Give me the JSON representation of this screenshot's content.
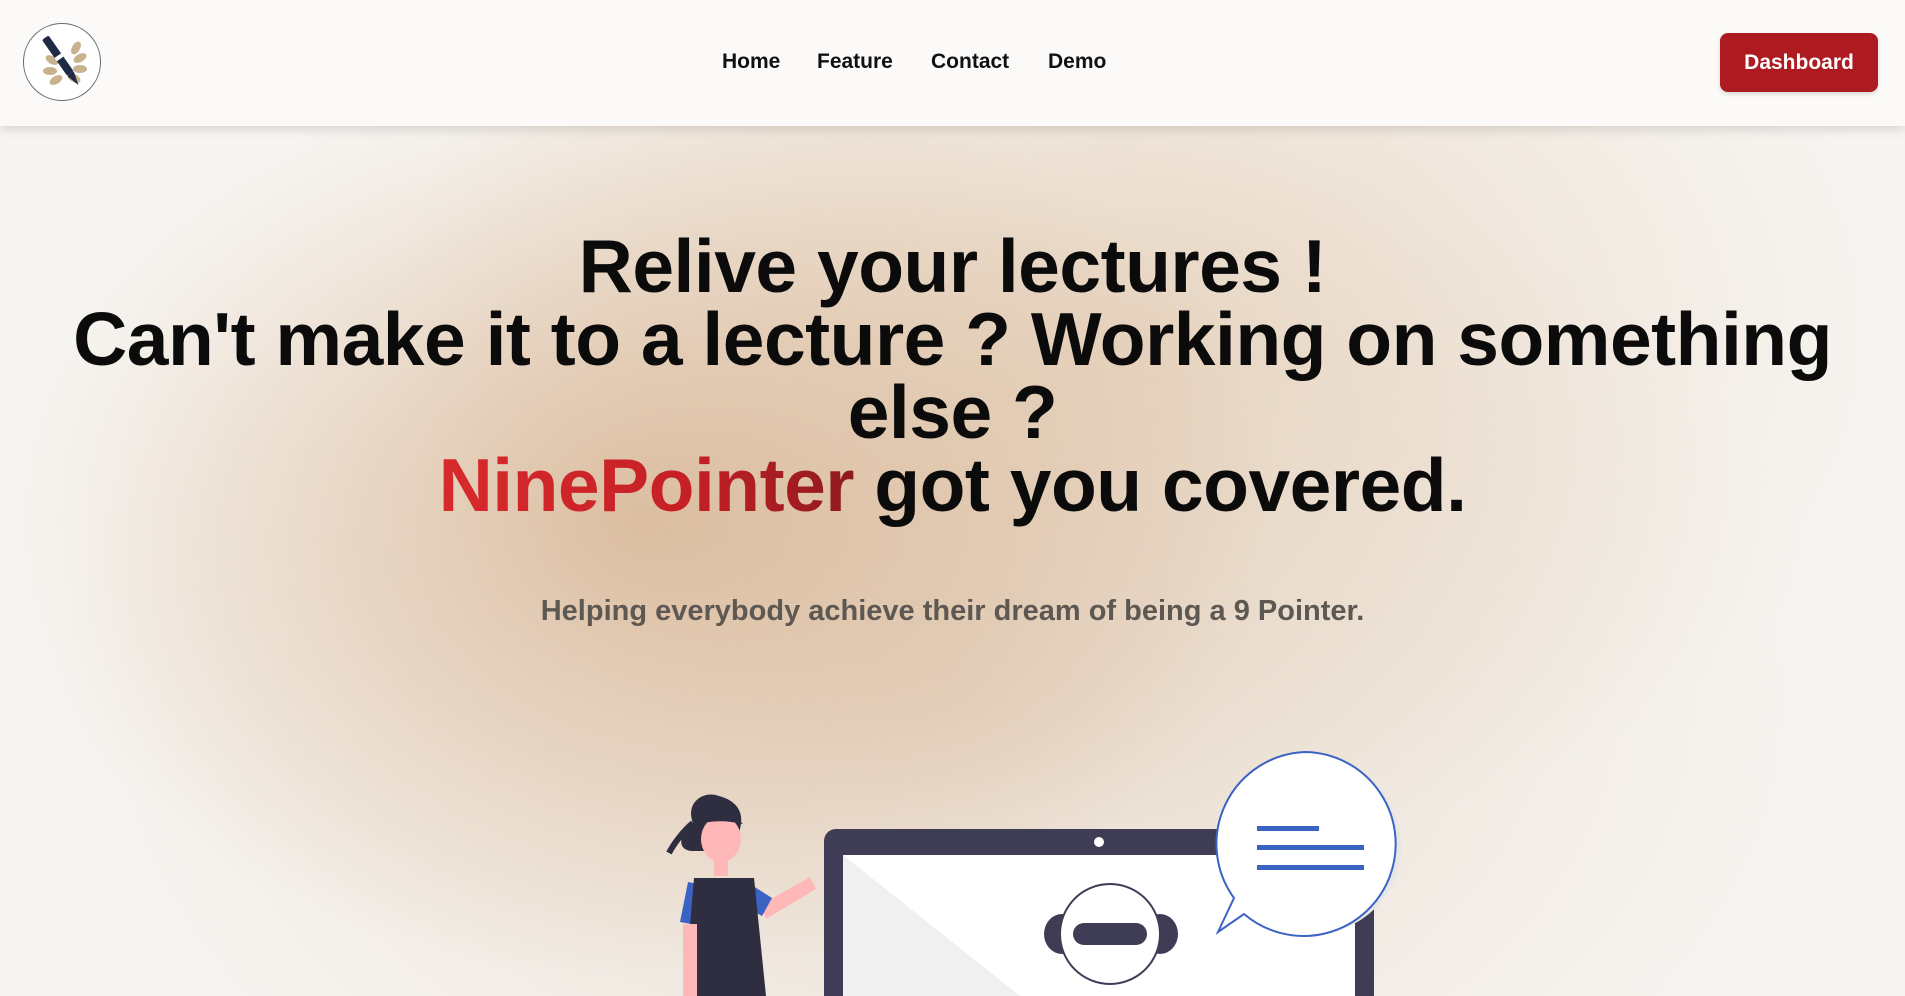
{
  "header": {
    "logo_icon": "pen-feather-logo-icon",
    "nav": [
      {
        "label": "Home"
      },
      {
        "label": "Feature"
      },
      {
        "label": "Contact"
      },
      {
        "label": "Demo"
      }
    ],
    "dashboard_label": "Dashboard"
  },
  "hero": {
    "line1": "Relive your lectures !",
    "line2": "Can't make it to a lecture ? Working on something",
    "line3": "else ?",
    "brand": "NinePointer",
    "line4_rest": " got you covered.",
    "subtitle": "Helping everybody achieve their dream of being a 9 Pointer."
  },
  "colors": {
    "accent": "#ad1b20",
    "brand_red": "#d82a2c",
    "illustration_blue": "#3b63c4",
    "laptop_dark": "#3f3d56"
  },
  "illustration": {
    "icons": [
      "person-illustration",
      "laptop-illustration",
      "chat-bubble-icon",
      "headset-avatar-icon"
    ]
  }
}
